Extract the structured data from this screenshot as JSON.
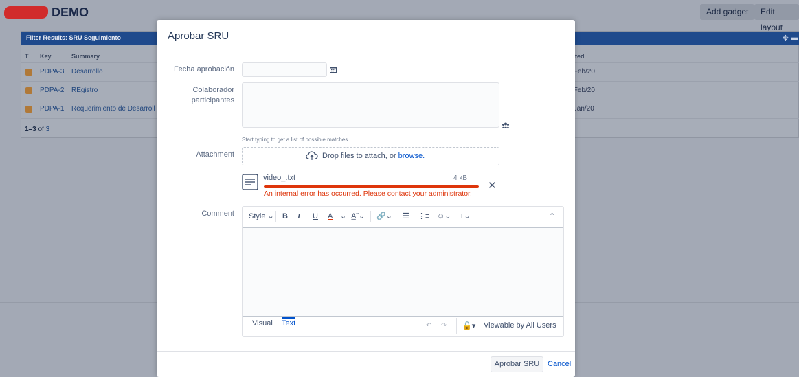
{
  "dashboard": {
    "title": "DEMO",
    "buttons": {
      "add_gadget": "Add gadget",
      "edit_layout": "Edit layout"
    },
    "gadget": {
      "title": "Filter Results: SRU Seguimiento",
      "columns": {
        "type": "T",
        "key": "Key",
        "summary": "Summary",
        "updated": "ated"
      },
      "rows": [
        {
          "key": "PDPA-3",
          "summary": "Desarrollo",
          "updated": "/Feb/20"
        },
        {
          "key": "PDPA-2",
          "summary": "REgistro",
          "updated": "/Feb/20"
        },
        {
          "key": "PDPA-1",
          "summary": "Requerimiento de Desarroll",
          "updated": "/Jan/20"
        }
      ],
      "count_range": "1–3",
      "count_of": "of",
      "count_total": "3"
    }
  },
  "dialog": {
    "title": "Aprobar SRU",
    "fields": {
      "fecha_label": "Fecha aprobación",
      "fecha_value": "",
      "colaborador_label": "Colaborador participantes",
      "colaborador_value": "",
      "colaborador_hint": "Start typing to get a list of possible matches.",
      "attachment_label": "Attachment",
      "comment_label": "Comment"
    },
    "dropzone": {
      "text": "Drop files to attach, or",
      "link": "browse."
    },
    "attachment_file": {
      "name": "video_.txt",
      "size": "4 kB",
      "error": "An internal error has occurred. Please contact your administrator.",
      "status_color": "#de350b"
    },
    "editor": {
      "style_label": "Style",
      "toolbar_icons": [
        "bold-icon",
        "italic-icon",
        "underline-icon",
        "text-color-icon",
        "text-format-icon",
        "link-icon",
        "bullet-list-icon",
        "numbered-list-icon",
        "emoji-icon",
        "insert-more-icon",
        "collapse-toolbar-icon"
      ],
      "tabs": {
        "visual": "Visual",
        "text": "Text"
      },
      "active_tab": "Text",
      "visibility": "Viewable by All Users"
    },
    "footer": {
      "submit": "Aprobar SRU",
      "cancel": "Cancel"
    },
    "accent_color": "#0052cc"
  }
}
